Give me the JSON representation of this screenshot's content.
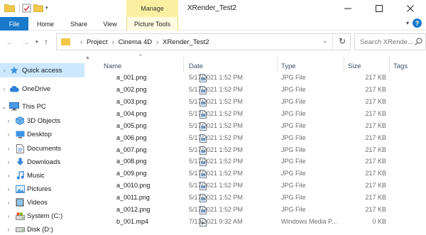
{
  "window": {
    "title": "XRender_Test2",
    "context_group": "Manage",
    "controls": [
      "minimize",
      "maximize",
      "close"
    ]
  },
  "ribbon": {
    "tabs": [
      {
        "label": "File"
      },
      {
        "label": "Home"
      },
      {
        "label": "Share"
      },
      {
        "label": "View"
      },
      {
        "label": "Picture Tools"
      }
    ]
  },
  "address": {
    "crumbs": [
      "Project",
      "Cinema 4D",
      "XRender_Test2"
    ]
  },
  "search": {
    "placeholder": "Search XRende..."
  },
  "nav": {
    "items": [
      {
        "label": "Quick access",
        "icon": "star-icon"
      },
      {
        "label": "OneDrive",
        "icon": "cloud-icon"
      },
      {
        "label": "This PC",
        "icon": "computer-icon"
      },
      {
        "label": "3D Objects",
        "icon": "cube-icon"
      },
      {
        "label": "Desktop",
        "icon": "desktop-icon"
      },
      {
        "label": "Documents",
        "icon": "document-icon"
      },
      {
        "label": "Downloads",
        "icon": "download-icon"
      },
      {
        "label": "Music",
        "icon": "music-icon"
      },
      {
        "label": "Pictures",
        "icon": "pictures-icon"
      },
      {
        "label": "Videos",
        "icon": "videos-icon"
      },
      {
        "label": "System (C:)",
        "icon": "drive-c-icon"
      },
      {
        "label": "Disk (D:)",
        "icon": "drive-d-icon"
      }
    ]
  },
  "columns": {
    "name": "Name",
    "date": "Date",
    "type": "Type",
    "size": "Size",
    "tags": "Tags"
  },
  "files": [
    {
      "name": "a_001.png",
      "date": "5/17/2021 1:52 PM",
      "type": "JPG File",
      "size": "217 KB"
    },
    {
      "name": "a_002.png",
      "date": "5/17/2021 1:52 PM",
      "type": "JPG File",
      "size": "217 KB"
    },
    {
      "name": "a_003.png",
      "date": "5/17/2021 1:52 PM",
      "type": "JPG File",
      "size": "217 KB"
    },
    {
      "name": "a_004.png",
      "date": "5/17/2021 1:52 PM",
      "type": "JPG File",
      "size": "217 KB"
    },
    {
      "name": "a_005.png",
      "date": "5/17/2021 1:52 PM",
      "type": "JPG File",
      "size": "217 KB"
    },
    {
      "name": "a_006.png",
      "date": "5/17/2021 1:52 PM",
      "type": "JPG File",
      "size": "217 KB"
    },
    {
      "name": "a_007.png",
      "date": "5/17/2021 1:52 PM",
      "type": "JPG File",
      "size": "217 KB"
    },
    {
      "name": "a_008.png",
      "date": "5/17/2021 1:52 PM",
      "type": "JPG File",
      "size": "217 KB"
    },
    {
      "name": "a_009.png",
      "date": "5/17/2021 1:52 PM",
      "type": "JPG File",
      "size": "217 KB"
    },
    {
      "name": "a_0010.png",
      "date": "5/17/2021 1:52 PM",
      "type": "JPG File",
      "size": "217 KB"
    },
    {
      "name": "a_0011.png",
      "date": "5/17/2021 1:52 PM",
      "type": "JPG File",
      "size": "217 KB"
    },
    {
      "name": "a_0012.png",
      "date": "5/17/2021 1:52 PM",
      "type": "JPG File",
      "size": "217 KB"
    },
    {
      "name": "b_001.mp4",
      "date": "7/13/2021 9:32 AM",
      "type": "Windows Media P...",
      "size": "0 KB"
    }
  ],
  "colors": {
    "accent": "#1979ca",
    "context_tab": "#fbf0a2",
    "selection": "#cce8ff",
    "folder": "#f3c74a",
    "header_text": "#3c5068"
  }
}
